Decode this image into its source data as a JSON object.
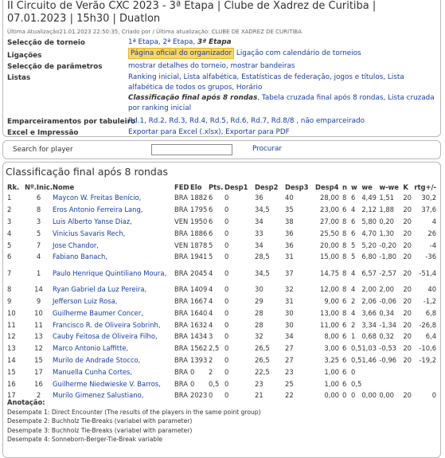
{
  "header": {
    "title": "II Circuito de Verão CXC 2023 - 3ª Etapa | Clube de Xadrez de Curitiba | 07.01.2023 | 15h30 | Duatlon",
    "updated": "Última Atualização21.01.2023 22:50:35, Criado por / Última atualização: CLUBE DE XADREZ DE CURITIBA"
  },
  "info": {
    "tournament_label": "Selecção de torneio",
    "tournament_values": [
      "1ª Etapa",
      "2ª Etapa",
      "3ª Etapa"
    ],
    "links_label": "Ligações",
    "links_official": "Página oficial do organizador",
    "links_calendar": "Ligação com calendário de torneios",
    "params_label": "Selecção de parâmetros",
    "params_details": "mostrar detalhes do torneio",
    "params_flags": "mostrar bandeiras",
    "lists_label": "Listas",
    "lists_line1": "Ranking inicial, Lista alfabética, Estatísticas de federação, jogos e títulos, Lista alfabética de todos os grupos, Horário",
    "lists_current": "Classificação final após 8 rondas",
    "lists_line2": ", Tabela cruzada final após 8 rondas, Lista cruzada por ranking inicial",
    "pairings_label": "Emparceiramentos por tabuleiro",
    "pairings_values": "Rd.1, Rd.2, Rd.3, Rd.4, Rd.5, Rd.6, Rd.7, Rd.8/8 , não emparceirado",
    "excel_label": "Excel e Impressão",
    "excel_values": "Exportar para Excel (.xlsx), Exportar para PDF"
  },
  "search": {
    "label": "Search for player",
    "value": "",
    "button": "Procurar"
  },
  "results": {
    "title": "Classificação final após 8 rondas",
    "columns": [
      "Rk.",
      "Nº.Inic.",
      "Nome",
      "FED",
      "Elo",
      "Pts.",
      "Desp1",
      "Desp2",
      "Desp3",
      "Desp4",
      "n",
      "w",
      "we",
      "w-we",
      "K",
      "rtg+/-"
    ],
    "rows": [
      [
        "1",
        "6",
        "Maycon W. Freitas Benício,",
        "BRA",
        "1882",
        "6",
        "0",
        "36",
        "40",
        "28,00",
        "8",
        "6",
        "4,49",
        "1,51",
        "20",
        "30,2"
      ],
      [
        "2",
        "8",
        "Eros Antonio Ferreira Lang,",
        "BRA",
        "1795",
        "6",
        "0",
        "34,5",
        "35",
        "23,00",
        "6",
        "4",
        "2,12",
        "1,88",
        "20",
        "37,6"
      ],
      [
        "3",
        "3",
        "Luis Alberto Yanse Diaz,",
        "VEN",
        "1950",
        "6",
        "0",
        "34",
        "38",
        "27,00",
        "8",
        "6",
        "5,80",
        "0,20",
        "20",
        "4"
      ],
      [
        "4",
        "5",
        "Vinicius Savaris Rech,",
        "BRA",
        "1886",
        "6",
        "0",
        "33",
        "36",
        "25,50",
        "8",
        "6",
        "4,70",
        "1,30",
        "20",
        "26"
      ],
      [
        "5",
        "7",
        "Jose Chandor,",
        "VEN",
        "1878",
        "5",
        "0",
        "34",
        "36",
        "20,00",
        "8",
        "5",
        "5,20",
        "-0,20",
        "20",
        "-4"
      ],
      [
        "6",
        "4",
        "Fabiano Banach,",
        "BRA",
        "1941",
        "5",
        "0",
        "28,5",
        "31",
        "15,00",
        "8",
        "5",
        "6,80",
        "-1,80",
        "20",
        "-36"
      ],
      [
        "7",
        "1",
        "Paulo Henrique Quintiliano Moura,",
        "BRA",
        "2045",
        "4",
        "0",
        "34,5",
        "37",
        "14,75",
        "8",
        "4",
        "6,57",
        "-2,57",
        "20",
        "-51,4"
      ],
      [
        "8",
        "14",
        "Ryan Gabriel da Luz Pereira,",
        "BRA",
        "1409",
        "4",
        "0",
        "30",
        "32",
        "12,00",
        "8",
        "4",
        "2,00",
        "2,00",
        "20",
        "40"
      ],
      [
        "9",
        "9",
        "Jefferson Luiz Rosa,",
        "BRA",
        "1667",
        "4",
        "0",
        "29",
        "31",
        "9,00",
        "6",
        "2",
        "2,06",
        "-0,06",
        "20",
        "-1,2"
      ],
      [
        "10",
        "10",
        "Guilherme Baumer Concer,",
        "BRA",
        "1640",
        "4",
        "0",
        "28",
        "30",
        "13,00",
        "8",
        "4",
        "3,66",
        "0,34",
        "20",
        "6,8"
      ],
      [
        "11",
        "11",
        "Francisco R. de Oliveira Sobrinh,",
        "BRA",
        "1632",
        "4",
        "0",
        "28",
        "30",
        "11,00",
        "6",
        "2",
        "3,34",
        "-1,34",
        "20",
        "-26,8"
      ],
      [
        "12",
        "13",
        "Cauby Feitosa de Oliveira Filho,",
        "BRA",
        "1434",
        "3",
        "0",
        "32",
        "34",
        "8,00",
        "6",
        "1",
        "0,68",
        "0,32",
        "20",
        "6,4"
      ],
      [
        "13",
        "12",
        "Marco Antonio Laffitte,",
        "BRA",
        "1562",
        "2,5",
        "0",
        "26,5",
        "27",
        "3,00",
        "6",
        "0,5",
        "1,03",
        "-0,53",
        "20",
        "-10,6"
      ],
      [
        "14",
        "15",
        "Murilo de Andrade Stocco,",
        "BRA",
        "1393",
        "2",
        "0",
        "26,5",
        "27",
        "3,25",
        "6",
        "0,5",
        "1,46",
        "-0,96",
        "20",
        "-19,2"
      ],
      [
        "15",
        "17",
        "Manuella Cunha Cortes,",
        "BRA",
        "0",
        "2",
        "0",
        "22,5",
        "23",
        "1,00",
        "6",
        "0",
        "",
        "",
        "",
        ""
      ],
      [
        "16",
        "16",
        "Guilherme Niedwieske V. Barros,",
        "BRA",
        "0",
        "0,5",
        "0",
        "23",
        "25",
        "1,00",
        "6",
        "0,5",
        "",
        "",
        "",
        ""
      ],
      [
        "17",
        "2",
        "Murilo Gimenez Salustiano,",
        "BRA",
        "2023",
        "0",
        "0",
        "21",
        "22",
        "0,00",
        "0",
        "0",
        "0,00",
        "0,00",
        "20",
        "0"
      ]
    ]
  },
  "notes": {
    "heading": "Anotação:",
    "lines": [
      "Desempate 1: Direct Encounter (The results of the players in the same point group)",
      "Desempate 2: Buchholz Tie-Breaks (variabel with parameter)",
      "Desempate 3: Buchholz Tie-Breaks (variabel with parameter)",
      "Desempate 4: Sonneborn-Berger-Tie-Break variable"
    ]
  }
}
